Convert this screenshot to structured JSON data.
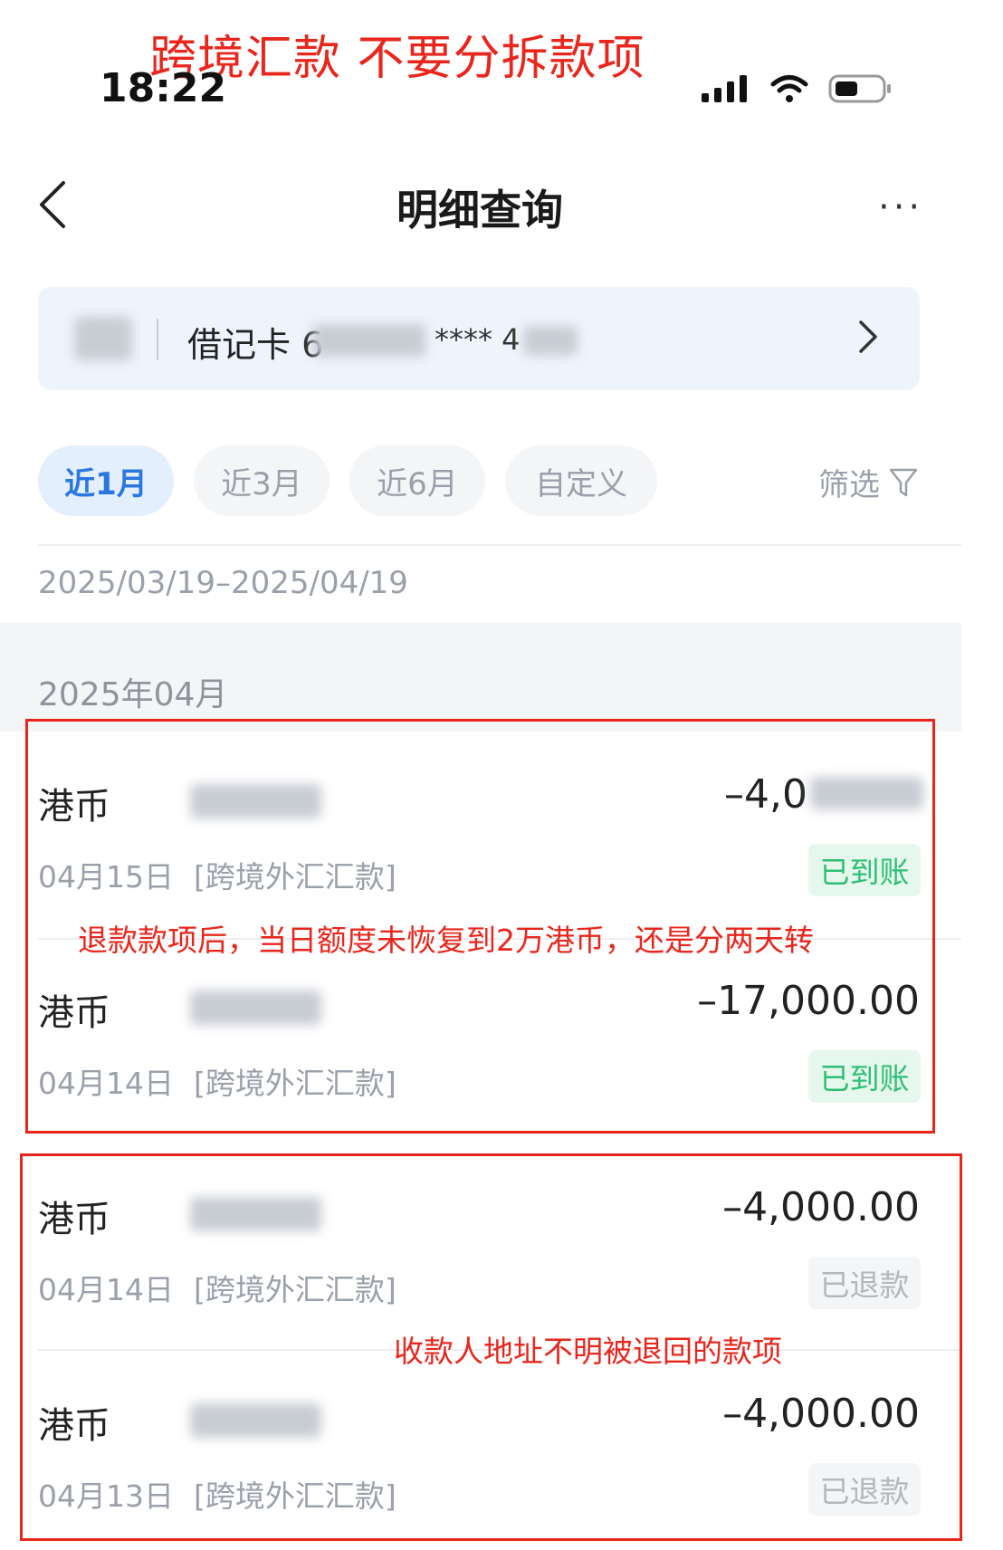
{
  "annotation": {
    "title": "跨境汇款 不要分拆款项",
    "note_retry": "退款款项后，当日额度未恢复到2万港币，还是分两天转",
    "note_returned": "收款人地址不明被退回的款项"
  },
  "status_bar": {
    "time": "18:22"
  },
  "nav": {
    "title": "明细查询",
    "more": "···"
  },
  "account": {
    "card_type": "借记卡 6",
    "masked": "**** 4"
  },
  "tabs": [
    {
      "label": "近1月",
      "active": true
    },
    {
      "label": "近3月",
      "active": false
    },
    {
      "label": "近6月",
      "active": false
    },
    {
      "label": "自定义",
      "active": false
    }
  ],
  "filter": {
    "label": "筛选"
  },
  "date_range": "2025/03/19–2025/04/19",
  "month_header": "2025年04月",
  "transactions": [
    {
      "currency": "港币",
      "amount": "–4,0",
      "date": "04月15日",
      "type": "[跨境外汇汇款]",
      "status": "已到账"
    },
    {
      "currency": "港币",
      "amount": "–17,000.00",
      "date": "04月14日",
      "type": "[跨境外汇汇款]",
      "status": "已到账"
    },
    {
      "currency": "港币",
      "amount": "–4,000.00",
      "date": "04月14日",
      "type": "[跨境外汇汇款]",
      "status": "已退款"
    },
    {
      "currency": "港币",
      "amount": "–4,000.00",
      "date": "04月13日",
      "type": "[跨境外汇汇款]",
      "status": "已退款"
    }
  ],
  "colors": {
    "accent": "#2a77e0",
    "annotation_red": "#e8261c",
    "arrived_green": "#2fbf72"
  }
}
